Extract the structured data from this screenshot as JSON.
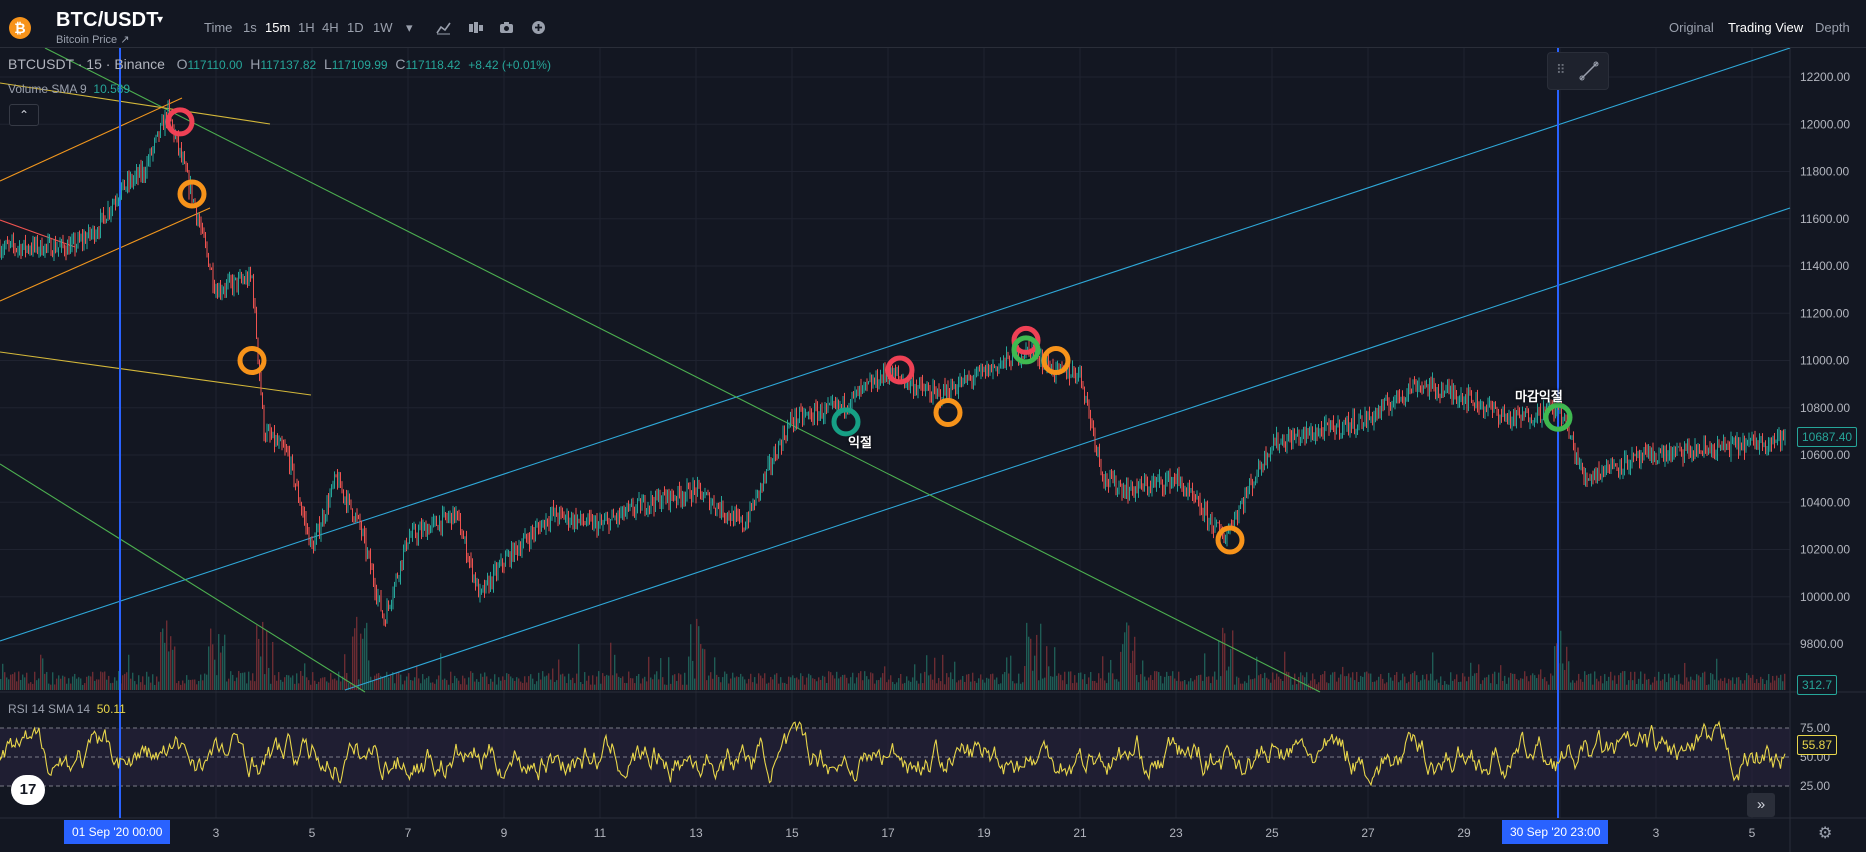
{
  "header": {
    "coin_glyph": "₿",
    "symbol": "BTC/USDT",
    "caret": "▾",
    "subtitle": "Bitcoin Price ↗",
    "timeframes": [
      "Time",
      "1s",
      "15m",
      "1H",
      "4H",
      "1D",
      "1W"
    ],
    "active_timeframe": "15m",
    "more_caret": "▾",
    "tools": [
      "chart-type-icon",
      "indicators-icon",
      "camera-icon",
      "add-icon"
    ],
    "views": [
      "Original",
      "Trading View",
      "Depth"
    ],
    "active_view": "Trading View"
  },
  "legend": {
    "instrument": "BTCUSDT · 15 · Binance",
    "open_label": "O",
    "open": "117110.00",
    "high_label": "H",
    "high": "117137.82",
    "low_label": "L",
    "low": "117109.99",
    "close_label": "C",
    "close": "117118.42",
    "change": "+8.42 (+0.01%)",
    "volume_label": "Volume SMA 9",
    "volume_value": "10.569",
    "collapse_glyph": "⌃"
  },
  "rsi_legend": {
    "label": "RSI 14 SMA 14",
    "value": "50.11"
  },
  "price_axis": {
    "labels": [
      "12200.00",
      "12000.00",
      "11800.00",
      "11600.00",
      "11400.00",
      "11200.00",
      "11000.00",
      "10800.00",
      "10600.00",
      "10400.00",
      "10200.00",
      "10000.00",
      "9800.00"
    ],
    "current_price": "10687.40",
    "volume_badge": "312.7",
    "rsi_labels": [
      "75.00",
      "50.00",
      "25.00"
    ],
    "rsi_current": "55.87"
  },
  "time_axis": {
    "labels": [
      "3",
      "5",
      "7",
      "9",
      "11",
      "13",
      "15",
      "17",
      "19",
      "21",
      "23",
      "25",
      "27",
      "29",
      "3",
      "5"
    ],
    "crosshair_left": "01 Sep '20   00:00",
    "crosshair_right": "30 Sep '20   23:00"
  },
  "annotations": {
    "label_a": "익절",
    "label_b": "마감익절"
  },
  "colors": {
    "up": "#26a69a",
    "down": "#ef5350",
    "rsi": "#e8d64b",
    "channel": "#2fa8d8",
    "trend_green": "#4caf50",
    "trend_yellow": "#d4b83a",
    "trend_orange": "#f0961e",
    "marker_red": "#ef4155",
    "marker_orange": "#f7931a",
    "marker_green": "#3fb950",
    "marker_teal": "#16a085",
    "vline": "#2962ff"
  },
  "chart_data": {
    "type": "candlestick",
    "title": "BTCUSDT · 15 · Binance",
    "ylim": [
      9700,
      12250
    ],
    "x_range": [
      "2020-08-31",
      "2020-10-06"
    ],
    "path_points": [
      [
        "2020-08-31",
        11480
      ],
      [
        "2020-08-31T12:00",
        11550
      ],
      [
        "2020-09-01",
        11720
      ],
      [
        "2020-09-01T12:00",
        11800
      ],
      [
        "2020-09-02",
        12050
      ],
      [
        "2020-09-02T12:00",
        11700
      ],
      [
        "2020-09-03",
        11300
      ],
      [
        "2020-09-03T18:00",
        11350
      ],
      [
        "2020-09-04",
        10700
      ],
      [
        "2020-09-04T12:00",
        10600
      ],
      [
        "2020-09-05",
        10200
      ],
      [
        "2020-09-05T12:00",
        10500
      ],
      [
        "2020-09-06",
        10300
      ],
      [
        "2020-09-06T12:00",
        9900
      ],
      [
        "2020-09-07",
        10250
      ],
      [
        "2020-09-08",
        10350
      ],
      [
        "2020-09-08T12:00",
        10000
      ],
      [
        "2020-09-09",
        10150
      ],
      [
        "2020-09-10",
        10350
      ],
      [
        "2020-09-11",
        10300
      ],
      [
        "2020-09-12",
        10400
      ],
      [
        "2020-09-13",
        10450
      ],
      [
        "2020-09-14",
        10300
      ],
      [
        "2020-09-14T18:00",
        10650
      ],
      [
        "2020-09-15",
        10750
      ],
      [
        "2020-09-16",
        10800
      ],
      [
        "2020-09-17",
        10950
      ],
      [
        "2020-09-18",
        10850
      ],
      [
        "2020-09-19",
        10950
      ],
      [
        "2020-09-20",
        11050
      ],
      [
        "2020-09-20T12:00",
        10950
      ],
      [
        "2020-09-21",
        10950
      ],
      [
        "2020-09-21T12:00",
        10500
      ],
      [
        "2020-09-22",
        10450
      ],
      [
        "2020-09-23",
        10500
      ],
      [
        "2020-09-24",
        10250
      ],
      [
        "2020-09-25",
        10650
      ],
      [
        "2020-09-26",
        10700
      ],
      [
        "2020-09-27",
        10750
      ],
      [
        "2020-09-28",
        10900
      ],
      [
        "2020-09-29",
        10850
      ],
      [
        "2020-09-30",
        10750
      ],
      [
        "2020-10-01",
        10800
      ],
      [
        "2020-10-01T12:00",
        10500
      ],
      [
        "2020-10-02",
        10550
      ],
      [
        "2020-10-03",
        10600
      ],
      [
        "2020-10-04",
        10620
      ],
      [
        "2020-10-05",
        10650
      ],
      [
        "2020-10-06",
        10687
      ]
    ],
    "volume_spike_dates": [
      "2020-09-02",
      "2020-09-03",
      "2020-09-04",
      "2020-09-06",
      "2020-09-13",
      "2020-09-20",
      "2020-09-22",
      "2020-09-24",
      "2020-10-01"
    ],
    "rsi_levels": [
      75,
      50,
      25
    ],
    "markers": [
      {
        "date": "2020-09-02T06:00",
        "price": 12010,
        "kind": "red"
      },
      {
        "date": "2020-09-02T12:00",
        "price": 11705,
        "kind": "orange"
      },
      {
        "date": "2020-09-03T18:00",
        "price": 11000,
        "kind": "orange"
      },
      {
        "date": "2020-09-16T03:00",
        "price": 10740,
        "kind": "teal"
      },
      {
        "date": "2020-09-17T06:00",
        "price": 10960,
        "kind": "red"
      },
      {
        "date": "2020-09-18T06:00",
        "price": 10780,
        "kind": "orange"
      },
      {
        "date": "2020-09-19T21:00",
        "price": 11085,
        "kind": "red"
      },
      {
        "date": "2020-09-19T21:00",
        "price": 11045,
        "kind": "green"
      },
      {
        "date": "2020-09-20T12:00",
        "price": 11000,
        "kind": "orange"
      },
      {
        "date": "2020-09-24T03:00",
        "price": 10240,
        "kind": "orange"
      },
      {
        "date": "2020-09-30T23:00",
        "price": 10760,
        "kind": "green"
      }
    ]
  }
}
